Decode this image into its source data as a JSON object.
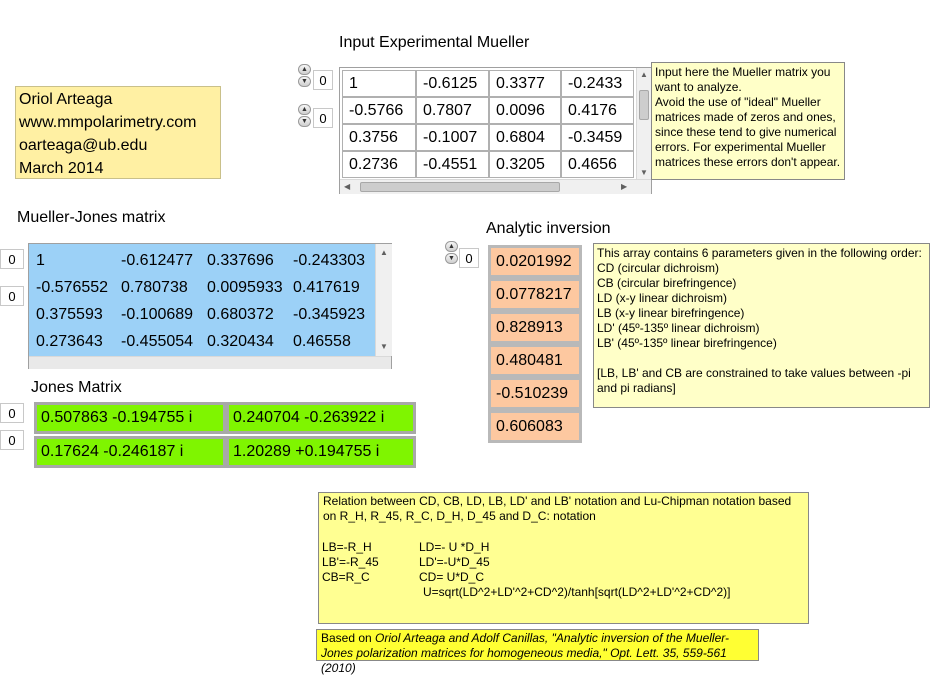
{
  "author": {
    "name": "Oriol Arteaga",
    "website": "www.mmpolarimetry.com",
    "email": "oarteaga@ub.edu",
    "date": "March 2014"
  },
  "input_matrix": {
    "title": "Input Experimental Mueller",
    "row_index": "0",
    "col_index": "0",
    "rows": [
      [
        "1",
        "-0.6125",
        "0.3377",
        "-0.2433"
      ],
      [
        "-0.5766",
        "0.7807",
        "0.0096",
        "0.4176"
      ],
      [
        "0.3756",
        "-0.1007",
        "0.6804",
        "-0.3459"
      ],
      [
        "0.2736",
        "-0.4551",
        "0.3205",
        "0.4656"
      ]
    ],
    "note": "Input here the Mueller matrix you want to analyze.\nAvoid the use of \"ideal\" Mueller matrices made of zeros and ones, since these tend to give numerical errors. For experimental Mueller matrices these errors don't appear."
  },
  "mueller_jones": {
    "title": "Mueller-Jones matrix",
    "row_index": "0",
    "col_index": "0",
    "rows": [
      [
        "1",
        "-0.612477",
        "0.337696",
        "-0.243303"
      ],
      [
        "-0.576552",
        "0.780738",
        "0.0095933",
        "0.417619"
      ],
      [
        "0.375593",
        "-0.100689",
        "0.680372",
        "-0.345923"
      ],
      [
        "0.273643",
        "-0.455054",
        "0.320434",
        "0.46558"
      ]
    ]
  },
  "jones": {
    "title": "Jones Matrix",
    "row_index": "0",
    "col_index": "0",
    "rows": [
      [
        "0.507863 -0.194755 i",
        "0.240704 -0.263922 i"
      ],
      [
        "0.17624 -0.246187 i",
        "1.20289 +0.194755 i"
      ]
    ]
  },
  "analytic": {
    "title": "Analytic inversion",
    "index": "0",
    "values": [
      "0.0201992",
      "0.0778217",
      "0.828913",
      "0.480481",
      "-0.510239",
      "0.606083"
    ],
    "note": "This array contains 6 parameters given in the following order:\nCD (circular dichroism)\nCB (circular birefringence)\nLD (x-y linear dichroism)\nLB (x-y linear birefringence)\nLD' (45º-135º linear dichroism)\nLB' (45º-135º linear birefringence)\n\n[LB, LB' and CB are constrained to take values between -pi and pi radians]"
  },
  "relation": {
    "heading": "Relation between CD, CB, LD, LB, LD' and LB' notation and Lu-Chipman notation based on R_H, R_45, R_C, D_H, D_45 and D_C: notation",
    "left": [
      "LB=-R_H",
      "LB'=-R_45",
      "CB=R_C"
    ],
    "right": [
      "LD=- U *D_H",
      "LD'=-U*D_45",
      "CD= U*D_C",
      "U=sqrt(LD^2+LD'^2+CD^2)/tanh[sqrt(LD^2+LD'^2+CD^2)]"
    ]
  },
  "reference": {
    "prefix": "Based on ",
    "authors": "Oriol Arteaga and Adolf Canillas",
    "title": ", \"Analytic inversion of the Mueller-Jones polarization matrices for homogeneous media,\"",
    "journal": " Opt. Lett. 35, 559-561 (2010)"
  },
  "colors": {
    "author_bg": "#fff0a3",
    "mueller_jones_bg": "#9cd1f7",
    "jones_cell_bg": "#7ff500",
    "analytic_cell_bg": "#fdc8a0",
    "note_bg": "#ffffc8",
    "reference_bg": "#ffff33"
  }
}
